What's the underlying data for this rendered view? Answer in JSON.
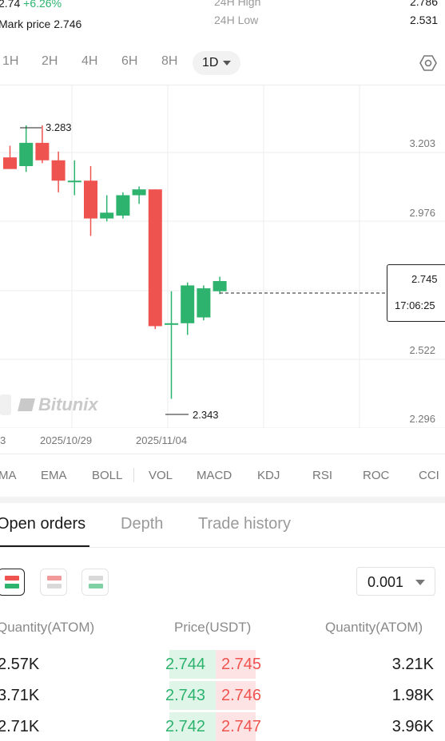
{
  "header": {
    "last_price": "2.74",
    "change_pct": "+6.26%",
    "mark_price_label": "Mark price",
    "mark_price": "2.746",
    "high_label": "24H High",
    "high_value": "2.786",
    "low_label": "24H Low",
    "low_value": "2.531"
  },
  "timeframes": [
    "1H",
    "2H",
    "4H",
    "6H",
    "8H"
  ],
  "active_timeframe": "1D",
  "chart": {
    "price_axis": [
      "3.203",
      "2.976",
      "2.522",
      "2.296"
    ],
    "date_axis": [
      "3",
      "2025/10/29",
      "2025/11/04"
    ],
    "high_marker": "3.283",
    "low_marker": "2.343",
    "current_price": "2.745",
    "countdown": "17:06:25",
    "watermark": "Bitunix",
    "colors": {
      "up": "#2db36e",
      "down": "#ef5350"
    }
  },
  "chart_data": {
    "type": "candlestick",
    "y_range": [
      2.24,
      3.42
    ],
    "candles": [
      {
        "o": 3.17,
        "h": 3.21,
        "l": 3.14,
        "c": 3.13
      },
      {
        "o": 3.14,
        "h": 3.28,
        "l": 3.12,
        "c": 3.22
      },
      {
        "o": 3.22,
        "h": 3.28,
        "l": 3.15,
        "c": 3.16
      },
      {
        "o": 3.16,
        "h": 3.19,
        "l": 3.05,
        "c": 3.09
      },
      {
        "o": 3.09,
        "h": 3.16,
        "l": 3.04,
        "c": 3.09
      },
      {
        "o": 3.09,
        "h": 3.14,
        "l": 2.9,
        "c": 2.96
      },
      {
        "o": 2.96,
        "h": 3.04,
        "l": 2.95,
        "c": 2.98
      },
      {
        "o": 2.97,
        "h": 3.05,
        "l": 2.96,
        "c": 3.04
      },
      {
        "o": 3.04,
        "h": 3.07,
        "l": 3.01,
        "c": 3.06
      },
      {
        "o": 3.06,
        "h": 3.06,
        "l": 2.58,
        "c": 2.59
      },
      {
        "o": 2.6,
        "h": 2.71,
        "l": 2.34,
        "c": 2.6
      },
      {
        "o": 2.6,
        "h": 2.74,
        "l": 2.56,
        "c": 2.73
      },
      {
        "o": 2.62,
        "h": 2.73,
        "l": 2.61,
        "c": 2.72
      },
      {
        "o": 2.71,
        "h": 2.76,
        "l": 2.7,
        "c": 2.745
      }
    ]
  },
  "indicators": [
    "MA",
    "EMA",
    "BOLL",
    "VOL",
    "MACD",
    "KDJ",
    "RSI",
    "ROC",
    "CCI"
  ],
  "tabs": [
    "Open orders",
    "Depth",
    "Trade history"
  ],
  "orderbook": {
    "precision": "0.001",
    "headers": {
      "bid_qty": "Quantity(ATOM)",
      "price": "Price(USDT)",
      "ask_qty": "Quantity(ATOM)"
    },
    "rows": [
      {
        "bid_qty": "2.57K",
        "bid_price": "2.744",
        "ask_price": "2.745",
        "ask_qty": "3.21K",
        "bid_depth": 0.55,
        "ask_depth": 0.45
      },
      {
        "bid_qty": "3.71K",
        "bid_price": "2.743",
        "ask_price": "2.746",
        "ask_qty": "1.98K",
        "bid_depth": 0.55,
        "ask_depth": 0.45
      },
      {
        "bid_qty": "2.71K",
        "bid_price": "2.742",
        "ask_price": "2.747",
        "ask_qty": "3.96K",
        "bid_depth": 0.55,
        "ask_depth": 0.45
      }
    ]
  }
}
